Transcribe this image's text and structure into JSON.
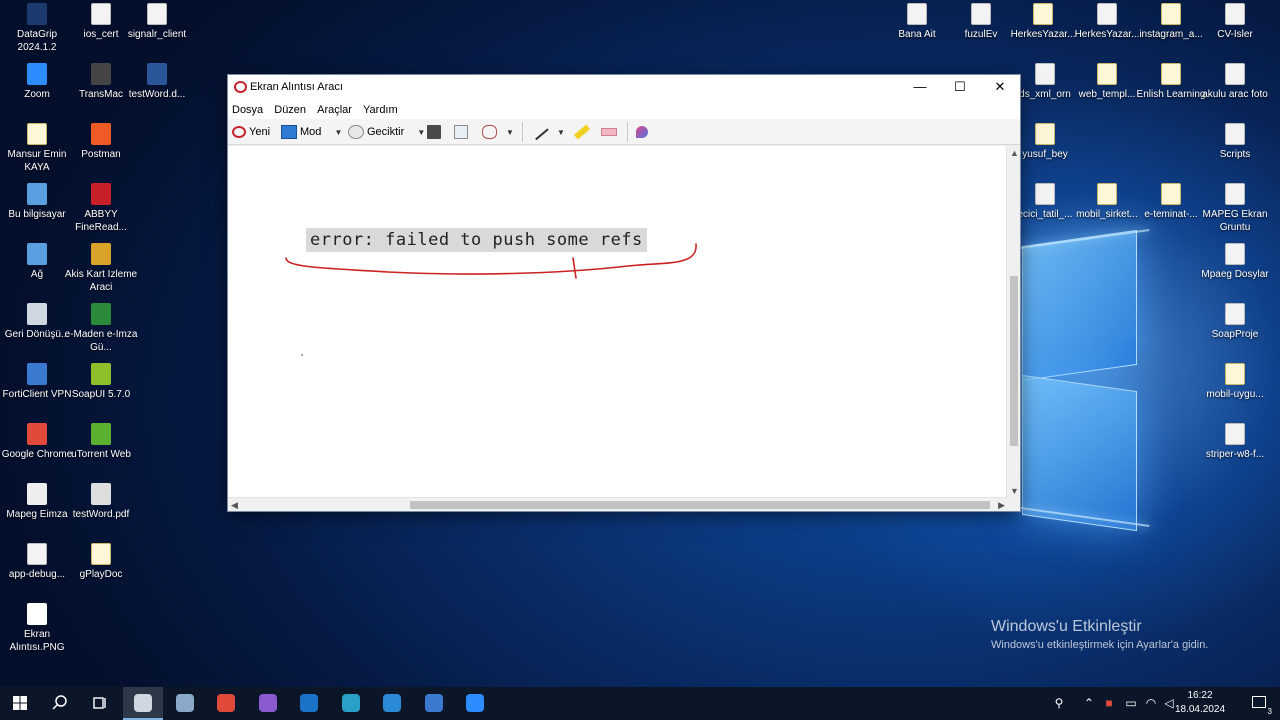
{
  "desktop_icons_left": [
    {
      "label": "DataGrip 2024.1.2",
      "icon": "datagrip-icon",
      "color": "#1d3a6e"
    },
    {
      "label": "ios_cert",
      "icon": "file-icon"
    },
    {
      "label": "signalr_client",
      "icon": "file-icon"
    },
    {
      "label": "Zoom",
      "icon": "zoom-icon",
      "color": "#2d8cff"
    },
    {
      "label": "TransMac",
      "icon": "transmac-icon",
      "color": "#444"
    },
    {
      "label": "testWord.d...",
      "icon": "word-doc-icon",
      "color": "#2b579a"
    },
    {
      "label": "Mansur Emin KAYA",
      "icon": "folder-icon"
    },
    {
      "label": "Postman",
      "icon": "postman-icon",
      "color": "#ef5b25"
    },
    {
      "label": "Bu bilgisayar",
      "icon": "computer-icon",
      "color": "#5aa0e0"
    },
    {
      "label": "ABBYY FineRead...",
      "icon": "abbyy-icon",
      "color": "#c8202a"
    },
    {
      "label": "Ağ",
      "icon": "network-icon",
      "color": "#5aa0e0"
    },
    {
      "label": "Akis Kart Izleme Araci",
      "icon": "akis-icon",
      "color": "#d9a32a"
    },
    {
      "label": "Geri Dönüşü...",
      "icon": "recycle-bin-icon",
      "color": "#cfd8e0"
    },
    {
      "label": "e-Maden e-Imza Gü...",
      "icon": "emaden-icon",
      "color": "#2a8a3a"
    },
    {
      "label": "FortiClient VPN",
      "icon": "forticlient-icon",
      "color": "#3a7ad0"
    },
    {
      "label": "SoapUI 5.7.0",
      "icon": "soapui-icon",
      "color": "#8fbf2a"
    },
    {
      "label": "Google Chrome",
      "icon": "chrome-icon",
      "color": "#e04a3a"
    },
    {
      "label": "uTorrent Web",
      "icon": "utorrent-icon",
      "color": "#5bb030"
    },
    {
      "label": "Mapeg Eimza",
      "icon": "mapeg-icon",
      "color": "#eeeeee"
    },
    {
      "label": "testWord.pdf",
      "icon": "pdf-icon",
      "color": "#dddddd"
    },
    {
      "label": "app-debug...",
      "icon": "file-icon"
    },
    {
      "label": "gPlayDoc",
      "icon": "folder-icon"
    },
    {
      "label": "Ekran Alıntısı.PNG",
      "icon": "image-file-icon",
      "color": "#ffffff"
    }
  ],
  "desktop_icons_right": [
    {
      "label": "Bana Ait",
      "icon": "file-icon"
    },
    {
      "label": "fuzulEv",
      "icon": "file-icon"
    },
    {
      "label": "HerkesYazar...",
      "icon": "folder-icon"
    },
    {
      "label": "HerkesYazar...",
      "icon": "file-icon"
    },
    {
      "label": "instagram_a...",
      "icon": "folder-icon"
    },
    {
      "label": "CV-Isler",
      "icon": "file-icon"
    },
    {
      "label": "ds_xml_orn",
      "icon": "file-icon"
    },
    {
      "label": "web_templ...",
      "icon": "folder-icon"
    },
    {
      "label": "Enlish Learning",
      "icon": "folder-icon"
    },
    {
      "label": "akulu arac foto",
      "icon": "file-icon"
    },
    {
      "label": "yusuf_bey",
      "icon": "folder-icon"
    },
    {
      "label": "Scripts",
      "icon": "file-icon"
    },
    {
      "label": "ecici_tatil_...",
      "icon": "file-icon"
    },
    {
      "label": "mobil_sirket...",
      "icon": "folder-icon"
    },
    {
      "label": "e-teminat-...",
      "icon": "folder-icon"
    },
    {
      "label": "MAPEG Ekran Gruntu",
      "icon": "file-icon"
    },
    {
      "label": "Mpaeg Dosylar",
      "icon": "file-icon"
    },
    {
      "label": "SoapProje",
      "icon": "file-icon"
    },
    {
      "label": "mobil-uygu...",
      "icon": "folder-icon"
    },
    {
      "label": "striper-w8-f...",
      "icon": "file-icon"
    }
  ],
  "window": {
    "title": "Ekran Alıntısı Aracı",
    "controls": {
      "minimize": "—",
      "maximize": "☐",
      "close": "✕"
    },
    "menu": [
      "Dosya",
      "Düzen",
      "Araçlar",
      "Yardım"
    ],
    "toolbar": {
      "new": "Yeni",
      "mode": "Mod",
      "delay": "Geciktir"
    },
    "snip_text": "error: failed to push some refs",
    "annotation_color": "#cc2222"
  },
  "watermark": {
    "title": "Windows'u Etkinleştir",
    "subtitle": "Windows'u etkinleştirmek için Ayarlar'a gidin."
  },
  "taskbar": {
    "time": "16:22",
    "date": "18.04.2024",
    "apps": [
      {
        "name": "snipping-tool",
        "color": "#cfd8e0",
        "active": true
      },
      {
        "name": "pgadmin",
        "color": "#8aa8c8"
      },
      {
        "name": "chrome",
        "color": "#e04a3a"
      },
      {
        "name": "visual-studio",
        "color": "#8a5ad0"
      },
      {
        "name": "outlook",
        "color": "#1a73c8"
      },
      {
        "name": "edge",
        "color": "#2aa0c8"
      },
      {
        "name": "vscode",
        "color": "#2a8ad8"
      },
      {
        "name": "forticlient",
        "color": "#3a7ad0"
      },
      {
        "name": "zoom",
        "color": "#2d8cff"
      }
    ],
    "notification_count": "3"
  }
}
